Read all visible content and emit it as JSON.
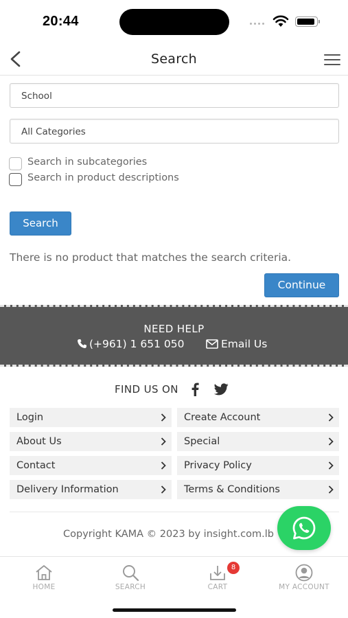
{
  "status_bar": {
    "time": "20:44"
  },
  "header": {
    "title": "Search"
  },
  "form": {
    "keyword_value": "School",
    "category_value": "All Categories",
    "subcategories_label": "Search in subcategories",
    "descriptions_label": "Search in product descriptions",
    "search_button": "Search"
  },
  "result": {
    "message": "There is no product that matches the search criteria.",
    "continue_button": "Continue"
  },
  "help": {
    "title": "NEED HELP",
    "phone": "(+961) 1 651 050",
    "email_label": "Email Us"
  },
  "social": {
    "label": "FIND US ON",
    "icons": [
      "facebook-icon",
      "twitter-icon"
    ]
  },
  "footer_links": {
    "login": "Login",
    "create_account": "Create Account",
    "about_us": "About Us",
    "special": "Special",
    "contact": "Contact",
    "privacy_policy": "Privacy Policy",
    "delivery_information": "Delivery Information",
    "terms_conditions": "Terms & Conditions"
  },
  "copyright": "Copyright KAMA © 2023 by insight.com.lb",
  "bottom_nav": {
    "home": "HOME",
    "search": "SEARCH",
    "cart": "CART",
    "cart_count": "8",
    "account": "MY ACCOUNT"
  },
  "colors": {
    "primary_button": "#3a86c8",
    "help_band": "#575757",
    "whatsapp": "#2bd366",
    "badge": "#e53935"
  }
}
